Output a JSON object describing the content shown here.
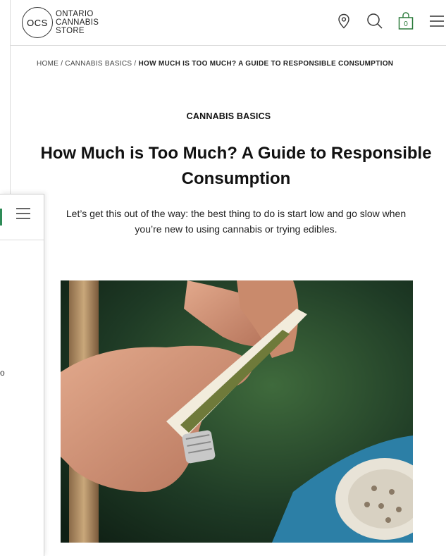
{
  "header": {
    "logo_badge": "OCS",
    "logo_lines": [
      "ONTARIO",
      "CANNABIS",
      "STORE"
    ],
    "cart_count": "0",
    "icons": [
      "location-pin-icon",
      "search-icon",
      "shopping-bag-icon",
      "hamburger-menu-icon"
    ]
  },
  "breadcrumb": {
    "items": [
      "HOME",
      "CANNABIS BASICS",
      "HOW MUCH IS TOO MUCH? A GUIDE TO RESPONSIBLE CONSUMPTION"
    ],
    "separator": "/"
  },
  "article": {
    "category": "CANNABIS BASICS",
    "title": "How Much is Too Much? A Guide to Responsible Consumption",
    "intro": "Let’s get this out of the way: the best thing to do is start low and go slow when you’re new to using cannabis or trying edibles."
  },
  "background_window": {
    "text_fragment": "o",
    "icons": [
      "hamburger-menu-icon"
    ]
  },
  "colors": {
    "accent_green": "#2a7a3a"
  }
}
